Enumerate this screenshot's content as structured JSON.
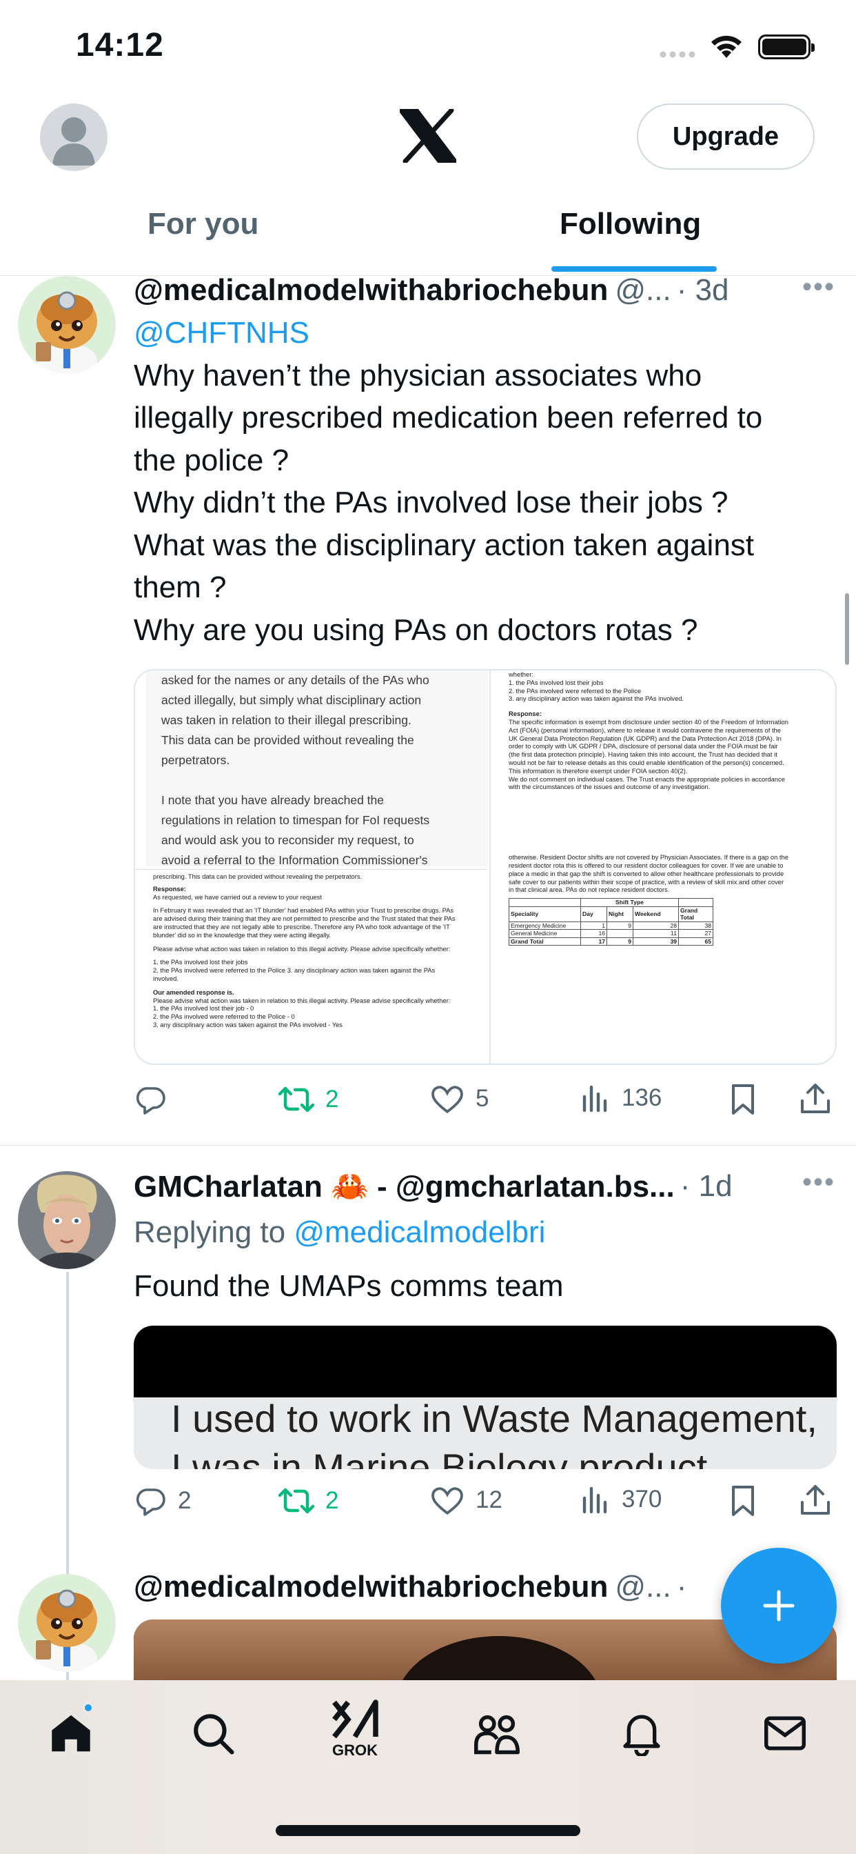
{
  "status_bar": {
    "time": "14:12"
  },
  "header": {
    "upgrade_label": "Upgrade",
    "tabs": [
      {
        "label": "For you",
        "active": false
      },
      {
        "label": "Following",
        "active": true
      }
    ],
    "accent": "#1d9bf0"
  },
  "tweets": [
    {
      "name": "@medicalmodelwithabriochebun",
      "handle": "@...",
      "time": "· 3d",
      "mention": "@CHFTNHS",
      "lines": [
        "Why haven’t the physician associates who",
        "illegally prescribed medication been referred to",
        "the police ?",
        "Why didn’t the PAs involved lose their jobs ?",
        "What was the disciplinary action taken against",
        "them ?",
        "Why are you using PAs on doctors rotas ?"
      ],
      "media": {
        "left_top_lines": [
          "asked for the names or any details of the PAs who",
          "acted illegally, but simply what disciplinary action",
          "was taken in relation to their illegal prescribing.",
          "This data can be provided without revealing the",
          "perpetrators.",
          "",
          "I note that you have already breached the",
          "regulations in relation to timespan for FoI requests",
          "and would ask you to reconsider my request, to",
          "avoid a referral to the Information Commissioner's"
        ],
        "left_bottom_lines": [
          "prescribing. This data can be provided without revealing the perpetrators.",
          "",
          "Response:",
          "As requested, we have carried out a review to your request",
          "",
          "In February it was revealed that an 'IT blunder' had enabled PAs within your Trust to prescribe drugs. PAs",
          "are advised during their training that they are not permitted to prescribe and the Trust stated that their PAs",
          "are instructed that they are not legally able to prescribe. Therefore any PA who took advantage of the 'IT",
          "blunder' did so in the knowledge that they were acting illegally.",
          "",
          "Please advise what action was taken in relation to this illegal activity. Please advise specifically whether:",
          "",
          "1. the PAs involved lost their jobs",
          "2. the PAs involved were referred to the Police 3. any disciplinary action was taken against the PAs",
          "involved.",
          "",
          "Our amended response is.",
          "Please advise what action was taken in relation to this illegal activity. Please advise specifically whether:",
          "1. the PAs involved lost their job - 0",
          "2. the PAs involved were referred to the Police - 0",
          "3. any disciplinary action was taken against the PAs involved - Yes"
        ],
        "right_top_lines": [
          "whether:",
          "1. the PAs involved lost their jobs",
          "2. the PAs involved were referred to the Police",
          "3. any disciplinary action was taken against the PAs involved.",
          "",
          "Response:",
          "The specific information is exempt from disclosure under section 40 of the Freedom of Information",
          "Act (FOIA) (personal information), where to release it would contravene the requirements of the",
          "UK General Data Protection Regulation (UK GDPR) and the Data Protection Act 2018 (DPA). In",
          "order to comply with UK GDPR / DPA, disclosure of personal data under the FOIA must be fair",
          "(the first data protection principle). Having taken this into account, the Trust has decided that it",
          "would not be fair to release details as this could enable identification of the person(s) concerned.",
          "This information is therefore exempt under FOIA section 40(2).",
          "We do not comment on individual cases. The Trust enacts the appropriate policies in accordance",
          "with the circumstances of the issues and outcome of any investigation."
        ],
        "right_bottom_lines": [
          "otherwise. Resident Doctor shifts are not covered by Physician Associates. If there is a gap on the",
          "resident doctor rota this is offered to our resident doctor colleagues for cover. If we are unable to",
          "place a medic in that gap the shift is converted to allow other healthcare professionals to provide",
          "safe cover to our patients within their scope of practice, with a review of skill mix and other cover",
          "in that clinical area. PAs do not replace resident doctors."
        ],
        "table": {
          "group_header": "Shift Type",
          "headers": [
            "Speciality",
            "Day",
            "Night",
            "Weekend",
            "Grand Total"
          ],
          "rows": [
            [
              "Emergency Medicine",
              "1",
              "9",
              "28",
              "38"
            ],
            [
              "General Medicine",
              "16",
              "",
              "11",
              "27"
            ],
            [
              "Grand Total",
              "17",
              "9",
              "39",
              "65"
            ]
          ]
        }
      },
      "stats": {
        "replies": "",
        "retweets": "2",
        "likes": "5",
        "views": "136"
      }
    },
    {
      "name": "GMCharlatan 🦀 - @gmcharlatan.bs...",
      "handle": "",
      "time": "· 1d",
      "replying_prefix": "Replying to ",
      "replying_to": "@medicalmodelbri",
      "text": "Found the UMAPs comms team",
      "media_caption": "I used to work in Waste Management,",
      "media_caption_2": "I was in Marine Biology product",
      "stats": {
        "replies": "2",
        "retweets": "2",
        "likes": "12",
        "views": "370"
      }
    },
    {
      "name": "@medicalmodelwithabriochebun",
      "handle": "@...",
      "time": "·"
    }
  ],
  "bottom_nav": {
    "grok_label": "GROK"
  }
}
